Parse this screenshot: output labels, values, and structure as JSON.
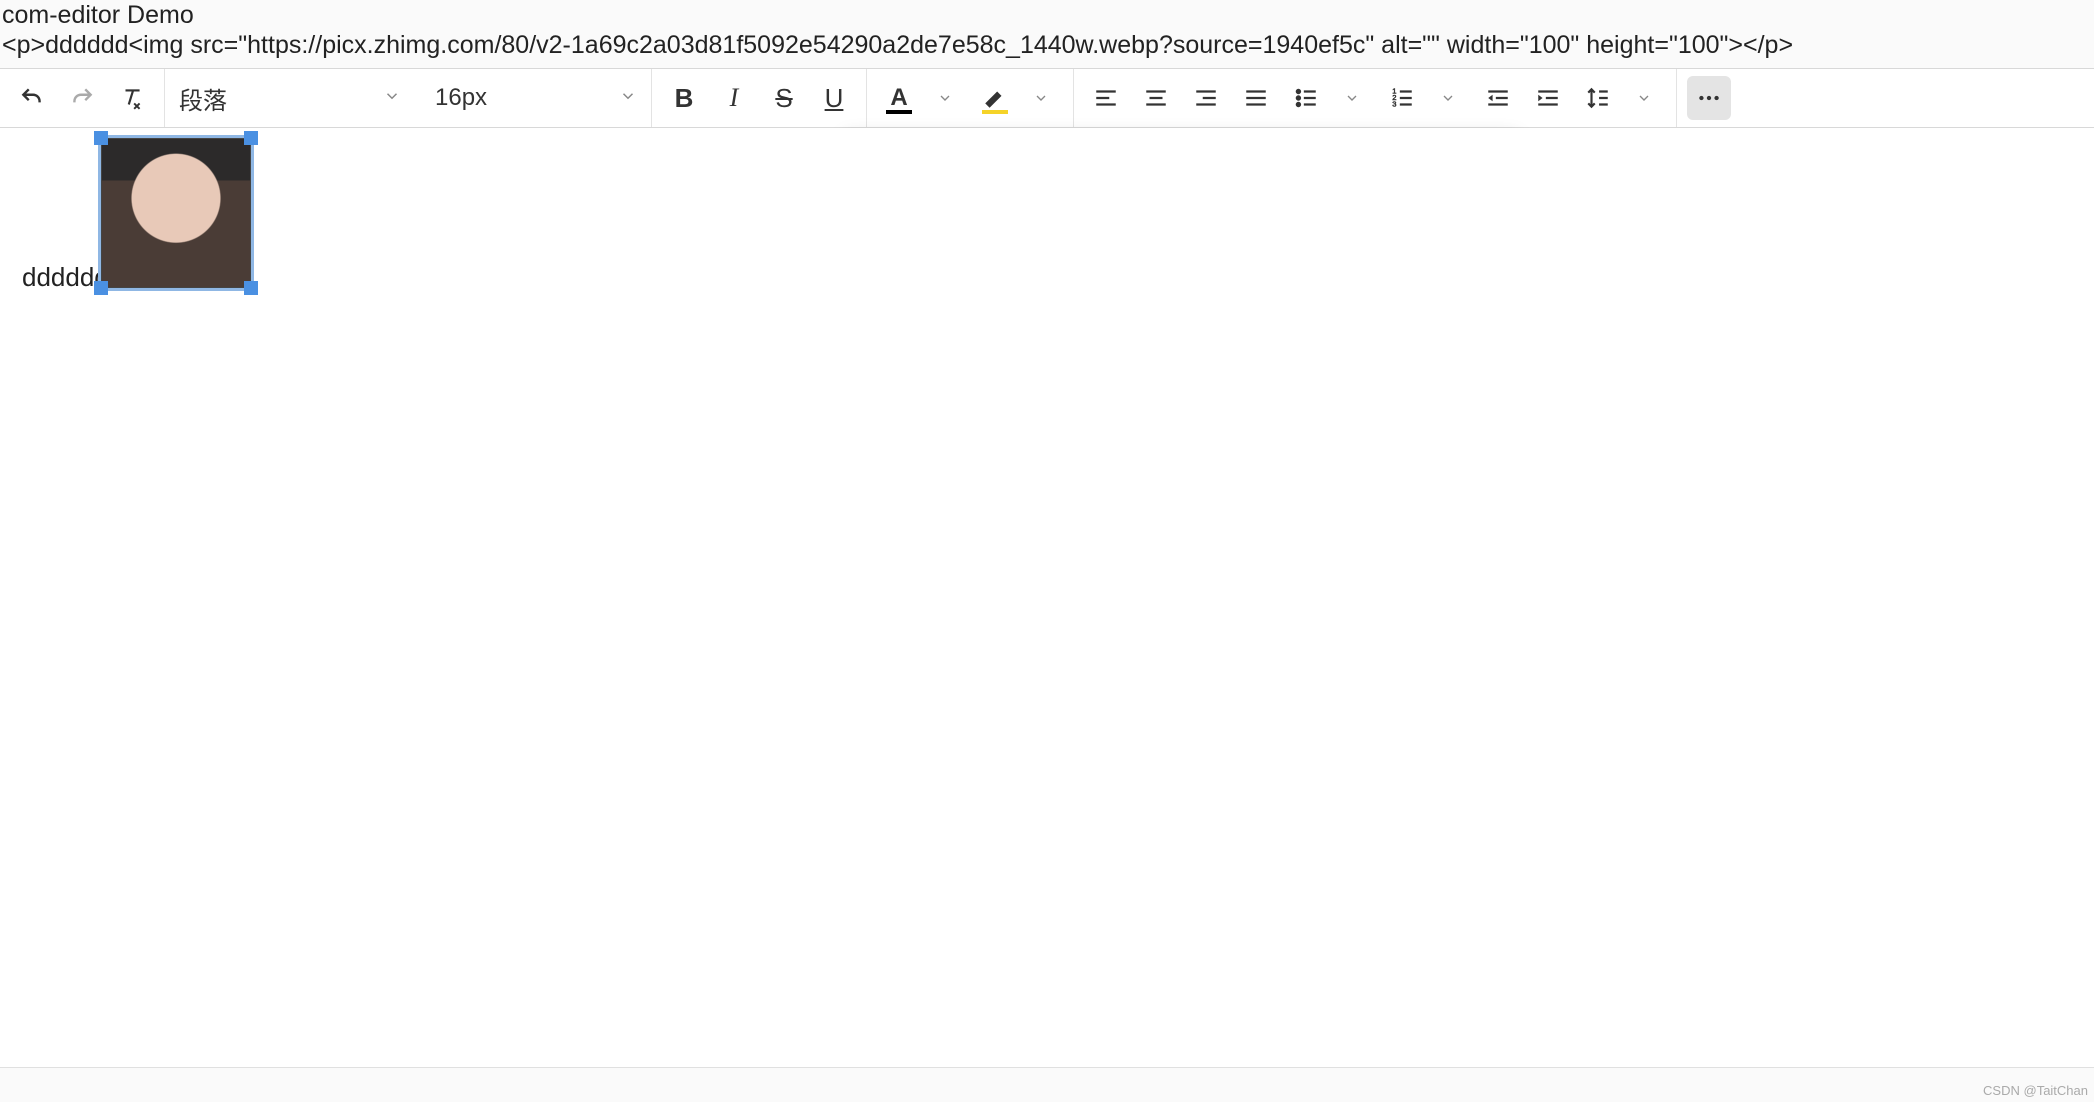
{
  "header": {
    "title": "com-editor Demo",
    "raw_html": "<p>dddddd<img src=\"https://picx.zhimg.com/80/v2-1a69c2a03d81f5092e54290a2de7e58c_1440w.webp?source=1940ef5c\" alt=\"\" width=\"100\" height=\"100\"></p>"
  },
  "toolbar": {
    "block_format": "段落",
    "font_size": "16px",
    "text_color": "#000000",
    "highlight_color": "#f5d328"
  },
  "editor": {
    "text": "dddddd",
    "image": {
      "width": 100,
      "height": 100,
      "selected": true
    }
  },
  "watermark": "CSDN @TaitChan",
  "icons": {
    "undo": "undo",
    "redo": "redo",
    "clear": "clear-format",
    "bold": "B",
    "italic": "I",
    "strike": "S",
    "underline": "U",
    "abc": "abc",
    "num": "123"
  }
}
